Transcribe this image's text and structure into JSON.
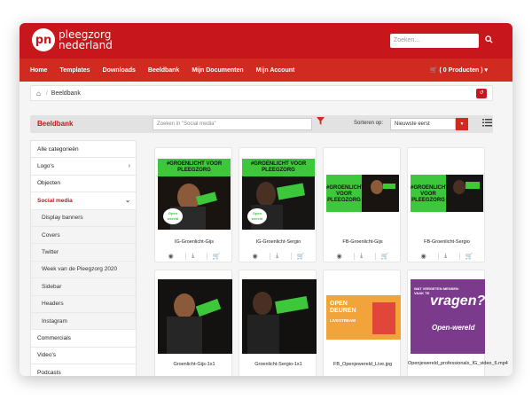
{
  "brand": {
    "logo_mark": "pn",
    "name_line1": "pleegzorg",
    "name_line2": "nederland"
  },
  "search": {
    "placeholder": "Zoeken..."
  },
  "nav": {
    "items": [
      "Home",
      "Templates",
      "Downloads",
      "Beeldbank",
      "Mijn Documenten",
      "Mijn Account"
    ],
    "cart_label": "( 0 Producten )"
  },
  "breadcrumb": {
    "current": "Beeldbank",
    "sep": "/"
  },
  "header": {
    "title": "Beeldbank",
    "filter_placeholder": "Zoeken in \"Social media\"",
    "sort_label": "Sorteren op:",
    "sort_value": "Nieuwste eerst"
  },
  "sidebar": {
    "items": [
      {
        "label": "Alle categorieën",
        "type": "top"
      },
      {
        "label": "Logo's",
        "type": "top",
        "chevron": "›"
      },
      {
        "label": "Objecten",
        "type": "top"
      },
      {
        "label": "Social media",
        "type": "active",
        "chevron": "⌄"
      },
      {
        "label": "Display banners",
        "type": "sub"
      },
      {
        "label": "Covers",
        "type": "sub"
      },
      {
        "label": "Twitter",
        "type": "sub"
      },
      {
        "label": "Week van de Pleegzorg 2020",
        "type": "sub"
      },
      {
        "label": "Sidebar",
        "type": "sub"
      },
      {
        "label": "Headers",
        "type": "sub"
      },
      {
        "label": "Instagram",
        "type": "sub"
      },
      {
        "label": "Commercials",
        "type": "top"
      },
      {
        "label": "Video's",
        "type": "top"
      },
      {
        "label": "Podcasts",
        "type": "top"
      }
    ]
  },
  "cards": [
    {
      "name": "IG-Groenlicht-Gijs",
      "banner": "#GROENLICHT VOOR PLEEGZORG",
      "stamp": "Open wereld"
    },
    {
      "name": "IG-Groenlicht-Sergio",
      "banner": "#GROENLICHT VOOR PLEEGZORG",
      "stamp": "Open wereld"
    },
    {
      "name": "FB-Groenlicht-Gijs",
      "banner": "#GROENLICHT VOOR PLEEGZORG"
    },
    {
      "name": "FB-Groenlicht-Sergio",
      "banner": "#GROENLICHT VOOR PLEEGZORG"
    },
    {
      "name": "Groenlicht-Gijs-1x1"
    },
    {
      "name": "Groenlicht-Sergio-1x1"
    },
    {
      "name": "FB_Openjewereld_Live.jpg",
      "banner": "OPEN DEUREN",
      "sub": "LIVESTREAM"
    },
    {
      "name": "Openjewereld_professionals_IG_video_6.mp4",
      "banner": "WAT VERGETEN MENSEN VAAK TE",
      "big": "vragen?",
      "stamp": "Open-wereld"
    }
  ],
  "icons": {
    "eye": "eye-icon",
    "download": "download-icon",
    "cart": "cart-icon"
  },
  "colors": {
    "brand_red": "#c8161d",
    "nav_red": "#d12a20",
    "green": "#3cc83a"
  }
}
